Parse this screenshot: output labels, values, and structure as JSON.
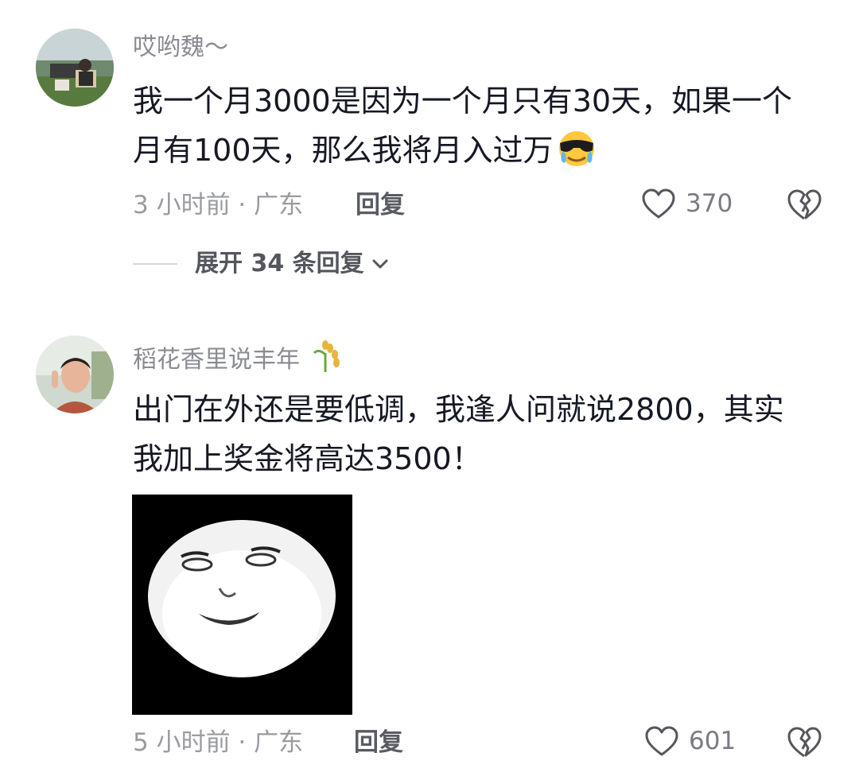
{
  "comments": [
    {
      "username": "哎哟魏～",
      "text": "我一个月3000是因为一个月只有30天，如果一个月有100天，那么我将月入过万",
      "emoji": "sunglasses-crying-emoji",
      "meta": "3 小时前 · 广东",
      "reply_label": "回复",
      "likes": "370",
      "expand_label": "展开 34 条回复"
    },
    {
      "username": "稻花香里说丰年",
      "username_emoji": "rice-ear-emoji",
      "text": "出门在外还是要低调，我逢人问就说2800，其实我加上奖金将高达3500！",
      "sticker": "panda-meme-sticker",
      "meta": "5 小时前 · 广东",
      "reply_label": "回复",
      "likes": "601"
    }
  ],
  "icons": {
    "like": "heart-outline-icon",
    "dislike": "broken-heart-icon",
    "expand": "chevron-down-icon"
  },
  "colors": {
    "text": "#161823",
    "secondary": "#9a9ba0",
    "icon": "#55565d"
  }
}
